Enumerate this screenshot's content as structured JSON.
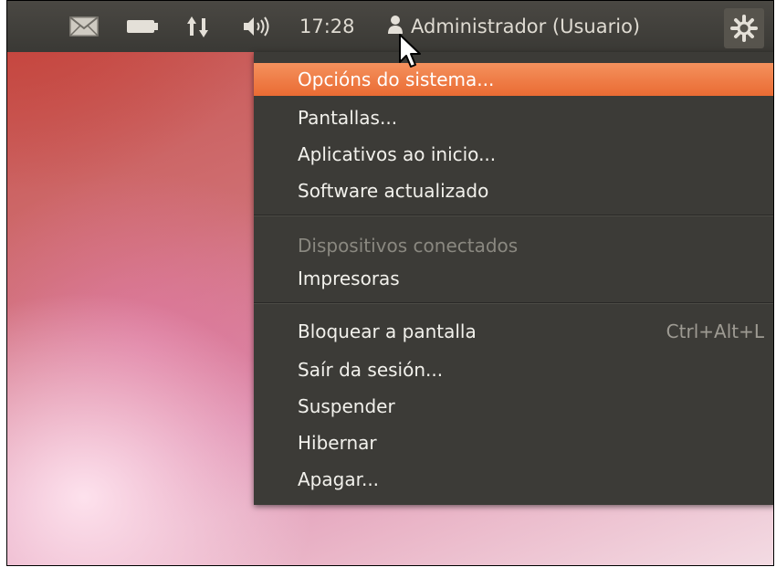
{
  "topbar": {
    "icons": [
      "envelope-icon",
      "battery-icon",
      "network-updown-icon",
      "volume-icon",
      "user-icon",
      "gear-icon"
    ],
    "time": "17:28",
    "user": "Administrador (Usuario)"
  },
  "menu": {
    "items": [
      {
        "label": "Opcións do sistema...",
        "state": "highlighted"
      },
      {
        "label": "Pantallas..."
      },
      {
        "label": "Aplicativos ao inicio..."
      },
      {
        "label": "Software actualizado"
      },
      {
        "label": "Dispositivos conectados",
        "state": "disabled"
      },
      {
        "label": "Impresoras"
      },
      {
        "label": "Bloquear a pantalla",
        "shortcut": "Ctrl+Alt+L"
      },
      {
        "label": "Saír da sesión..."
      },
      {
        "label": "Suspender"
      },
      {
        "label": "Hibernar"
      },
      {
        "label": "Apagar..."
      }
    ]
  },
  "colors": {
    "panel": "#3c3b37",
    "highlight": "#f07746",
    "text": "#f2f1ec",
    "disabled_text": "#8a8880"
  }
}
